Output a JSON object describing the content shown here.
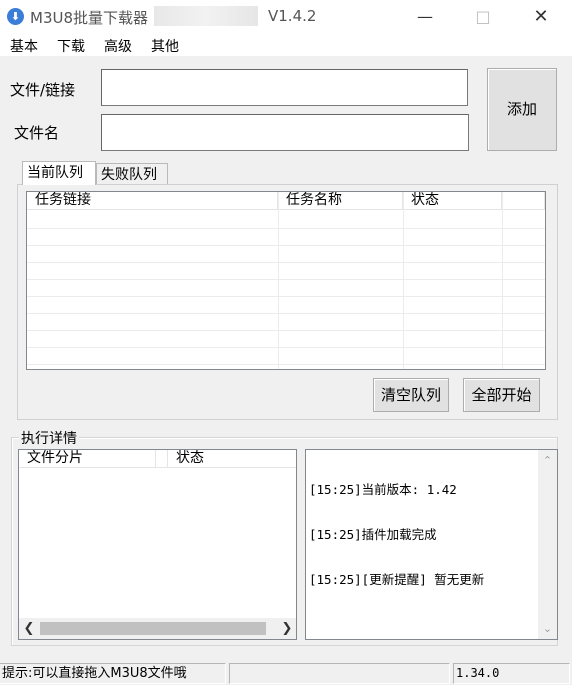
{
  "window": {
    "title": "M3U8批量下载器",
    "version": "V1.4.2",
    "minimize": "—",
    "maximize": "□",
    "close": "✕"
  },
  "menu": [
    "基本",
    "下载",
    "高级",
    "其他"
  ],
  "form": {
    "url_label": "文件/链接",
    "url_value": "",
    "name_label": "文件名",
    "name_value": "",
    "add_button": "添加"
  },
  "tabs": [
    "当前队列",
    "失败队列"
  ],
  "queue_table": {
    "columns": [
      "任务链接",
      "任务名称",
      "状态",
      ""
    ],
    "rows": []
  },
  "queue_buttons": {
    "clear": "清空队列",
    "start_all": "全部开始"
  },
  "details": {
    "group_title": "执行详情",
    "columns": [
      "文件分片",
      "",
      "状态"
    ],
    "log": [
      "[15:25]当前版本: 1.42",
      "[15:25]插件加载完成",
      "[15:25][更新提醒] 暂无更新"
    ]
  },
  "statusbar": {
    "hint": "提示:可以直接拖入M3U8文件哦",
    "middle": "",
    "right": "1.34.0"
  }
}
